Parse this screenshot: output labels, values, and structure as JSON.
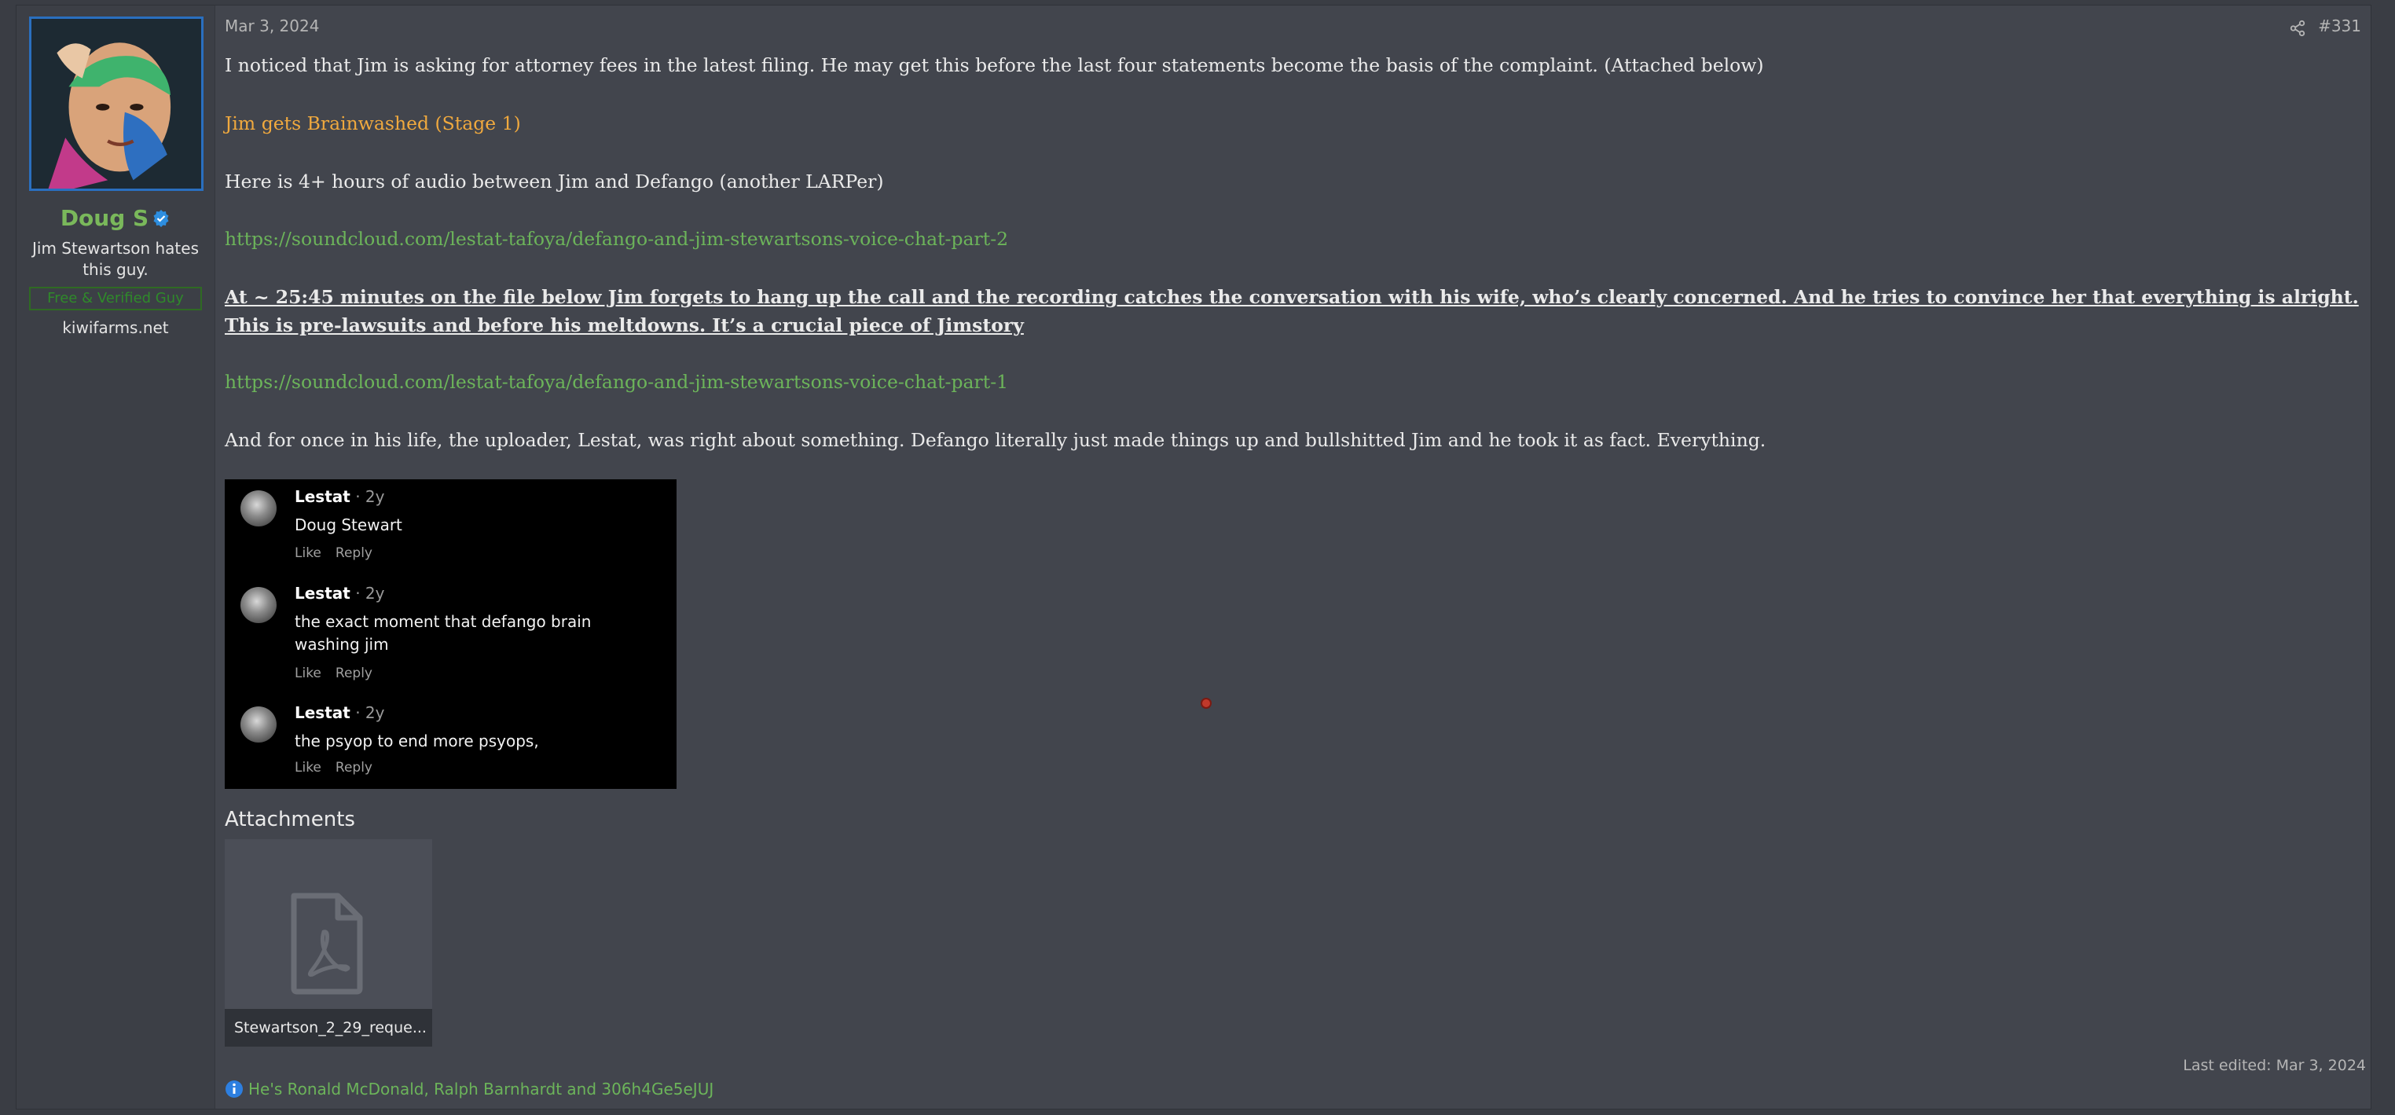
{
  "user": {
    "name": "Doug S",
    "title": "Jim Stewartson hates this guy.",
    "banner": "Free & Verified Guy",
    "site": "kiwifarms.net",
    "avatar_icon": "avatar-image",
    "verified_icon": "verified-badge-icon"
  },
  "post": {
    "date": "Mar 3, 2024",
    "number": "#331",
    "share_icon": "share-icon",
    "paragraphs": {
      "p1": "I noticed that Jim is asking for attorney fees in the latest filing. He may get this before the last four statements become the basis of the complaint. (Attached below)",
      "p2": "Jim gets Brainwashed (Stage 1)",
      "p3": "Here is 4+ hours of audio between Jim and Defango (another LARPer)",
      "p4": "https://soundcloud.com/lestat-tafoya/defango-and-jim-stewartsons-voice-chat-part-2",
      "p5": "At ~ 25:45 minutes on the file below Jim forgets to hang up the call and the recording catches the conversation with his wife, who’s clearly concerned. And he tries to convince her that everything is alright. This is pre-lawsuits and before his meltdowns. It’s a crucial piece of Jimstory",
      "p6": "https://soundcloud.com/lestat-tafoya/defango-and-jim-stewartsons-voice-chat-part-1",
      "p7": "And for once in his life, the uploader, Lestat, was right about something. Defango literally just made things up and bullshitted Jim and he took it as fact. Everything."
    },
    "embed_comments": [
      {
        "author": "Lestat",
        "age": " · 2y",
        "text": "Doug Stewart",
        "like": "Like",
        "reply": "Reply"
      },
      {
        "author": "Lestat",
        "age": " · 2y",
        "text": "the exact moment that defango brain washing jim",
        "like": "Like",
        "reply": "Reply"
      },
      {
        "author": "Lestat",
        "age": " · 2y",
        "text": "the psyop to end more psyops,",
        "like": "Like",
        "reply": "Reply"
      }
    ],
    "attachments_heading": "Attachments",
    "attachment": {
      "name": "Stewartson_2_29_reque...",
      "icon": "pdf-file-icon"
    },
    "last_edited": "Last edited: Mar 3, 2024",
    "reactions": {
      "icon": "info-icon",
      "text": "He's Ronald McDonald, Ralph Barnhardt and 306h4Ge5eJUJ"
    }
  },
  "colors": {
    "background": "#3a3d44",
    "post_bg": "#42454d",
    "username": "#7ab85b",
    "link": "#6cb45a",
    "heading_orange": "#f0a93e"
  }
}
